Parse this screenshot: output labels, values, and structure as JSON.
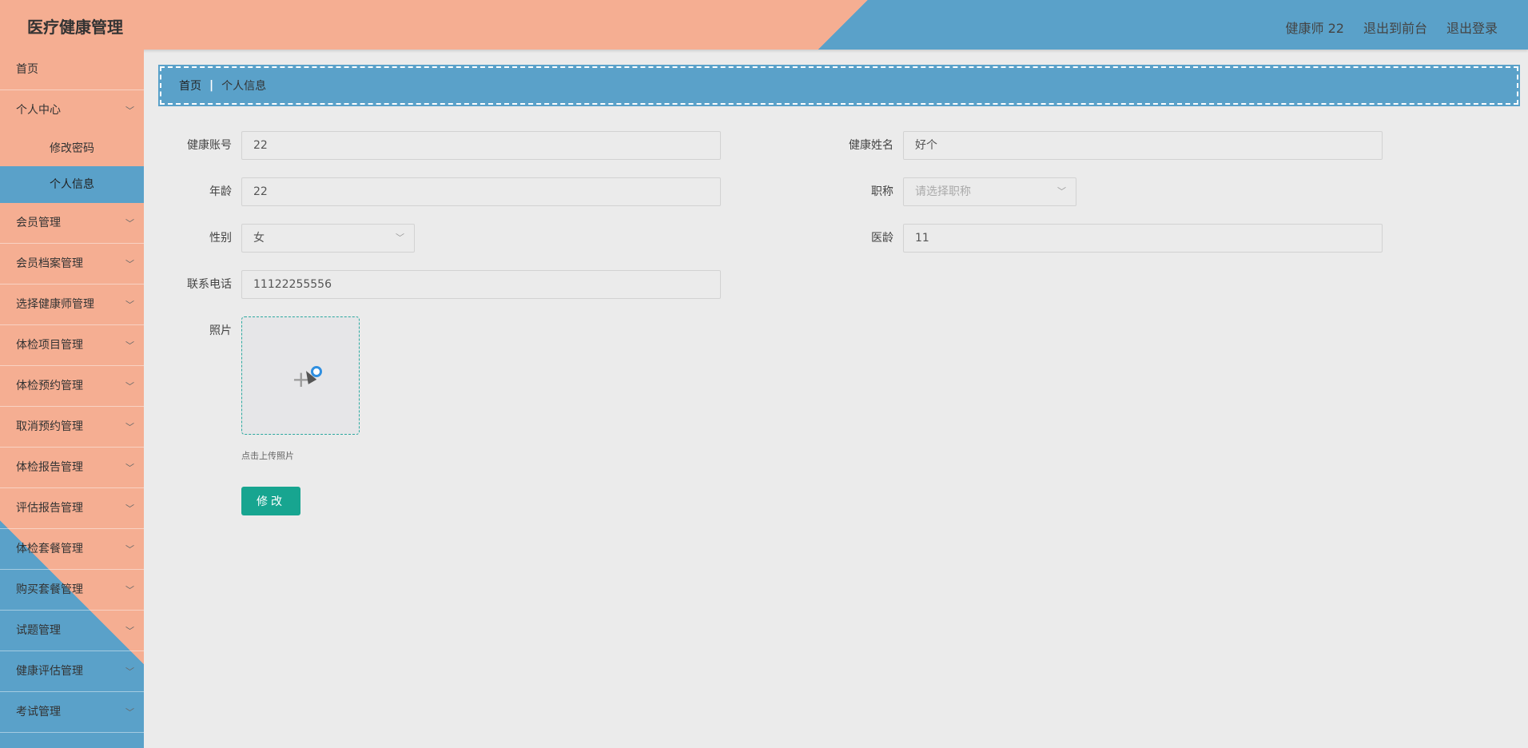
{
  "header": {
    "app_title": "医疗健康管理",
    "user_label": "健康师 22",
    "to_front": "退出到前台",
    "logout": "退出登录"
  },
  "sidebar": {
    "items": [
      {
        "label": "首页"
      },
      {
        "label": "个人中心"
      },
      {
        "label": "修改密码"
      },
      {
        "label": "个人信息"
      },
      {
        "label": "会员管理"
      },
      {
        "label": "会员档案管理"
      },
      {
        "label": "选择健康师管理"
      },
      {
        "label": "体检项目管理"
      },
      {
        "label": "体检预约管理"
      },
      {
        "label": "取消预约管理"
      },
      {
        "label": "体检报告管理"
      },
      {
        "label": "评估报告管理"
      },
      {
        "label": "体检套餐管理"
      },
      {
        "label": "购买套餐管理"
      },
      {
        "label": "试题管理"
      },
      {
        "label": "健康评估管理"
      },
      {
        "label": "考试管理"
      }
    ]
  },
  "breadcrumb": {
    "home": "首页",
    "separator": "|",
    "current": "个人信息"
  },
  "form": {
    "account_label": "健康账号",
    "account_value": "22",
    "name_label": "健康姓名",
    "name_value": "好个",
    "age_label": "年龄",
    "age_value": "22",
    "title_label": "职称",
    "title_placeholder": "请选择职称",
    "gender_label": "性别",
    "gender_value": "女",
    "seniority_label": "医龄",
    "seniority_value": "11",
    "phone_label": "联系电话",
    "phone_value": "11122255556",
    "photo_label": "照片",
    "upload_hint": "点击上传照片",
    "submit_label": "修改"
  },
  "colors": {
    "salmon": "#f5ae92",
    "blue": "#5aa1c9",
    "submit": "#17a590"
  }
}
